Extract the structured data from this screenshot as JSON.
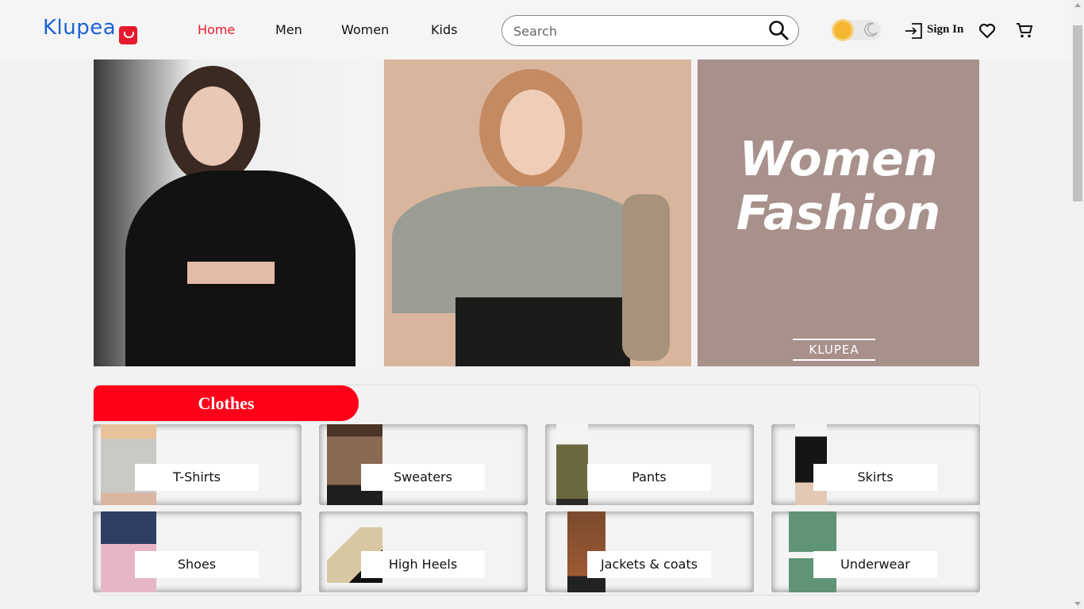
{
  "header": {
    "logo": "Klupea",
    "nav": [
      {
        "label": "Home",
        "active": true
      },
      {
        "label": "Men",
        "active": false
      },
      {
        "label": "Women",
        "active": false
      },
      {
        "label": "Kids",
        "active": false
      }
    ],
    "search_placeholder": "Search",
    "sign_in": "Sign In",
    "icons": [
      "search-icon",
      "sun-icon",
      "moon-icon",
      "sign-in-icon",
      "heart-icon",
      "cart-icon"
    ]
  },
  "banners": {
    "title_line1": "Women",
    "title_line2": "Fashion",
    "brand": "KLUPEA"
  },
  "section": {
    "title": "Clothes",
    "categories": [
      {
        "label": "T-Shirts"
      },
      {
        "label": "Sweaters"
      },
      {
        "label": "Pants"
      },
      {
        "label": "Skirts"
      },
      {
        "label": "Shoes"
      },
      {
        "label": "High Heels"
      },
      {
        "label": "Jackets & coats"
      },
      {
        "label": "Underwear"
      }
    ]
  },
  "colors": {
    "brand_blue": "#1a63d6",
    "accent_red": "#ff0019",
    "active_nav": "#e8192c"
  }
}
